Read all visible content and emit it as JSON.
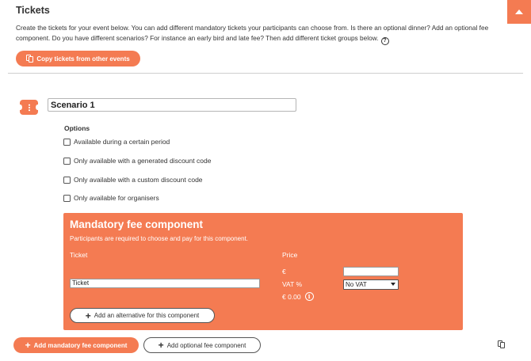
{
  "header": {
    "title": "Tickets",
    "intro": "Create the tickets for your event below. You can add different mandatory tickets your participants can choose from. Is there an optional dinner? Add an optional fee component. Do you have different scenarios? For instance an early bird and late fee? Then add different ticket groups below.",
    "help_glyph": "?",
    "copy_button_label": "Copy tickets from other events"
  },
  "scenario": {
    "name": "Scenario 1",
    "options_label": "Options",
    "options": [
      {
        "label": "Available during a certain period",
        "checked": false
      },
      {
        "label": "Only available with a generated discount code",
        "checked": false
      },
      {
        "label": "Only available with a custom discount code",
        "checked": false
      },
      {
        "label": "Only available for organisers",
        "checked": false
      }
    ]
  },
  "mandatory_fee": {
    "title": "Mandatory fee component",
    "description": "Participants are required to choose and pay for this component.",
    "ticket_column": "Ticket",
    "price_column": "Price",
    "ticket_name_value": "Ticket",
    "currency_symbol": "€",
    "price_value": "",
    "vat_label": "VAT %",
    "vat_selected": "No VAT",
    "total": "€ 0.00",
    "info_glyph": "i",
    "add_alternative_label": "Add an alternative for this component"
  },
  "footer": {
    "add_mandatory_label": "Add mandatory fee component",
    "add_optional_label": "Add optional fee component"
  },
  "colors": {
    "accent": "#f47b52"
  },
  "icons": {
    "scroll_top": "triangle-up-icon",
    "copy": "copy-icon",
    "ticket": "ticket-icon",
    "plus": "plus-icon",
    "info": "info-icon",
    "help": "question-circle-icon"
  }
}
